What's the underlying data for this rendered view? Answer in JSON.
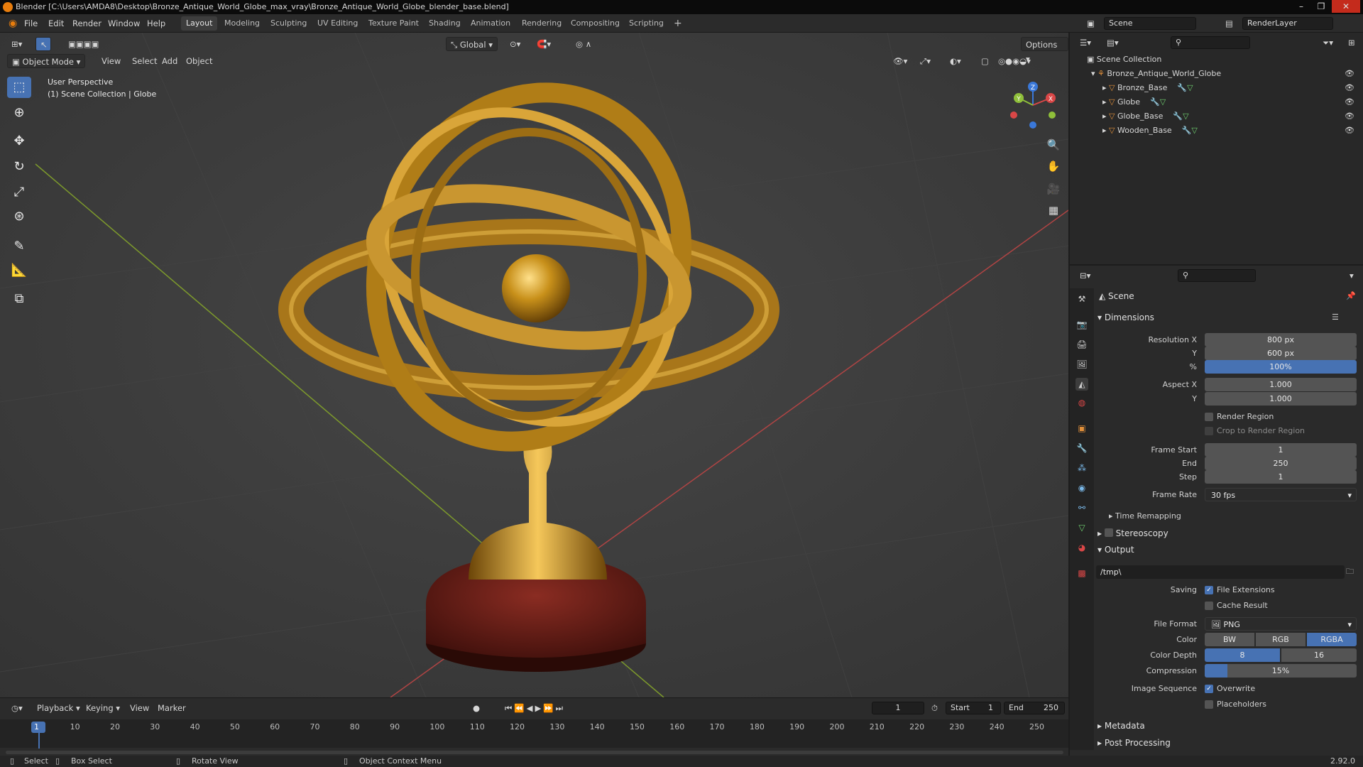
{
  "window": {
    "title": "Blender [C:\\Users\\AMDA8\\Desktop\\Bronze_Antique_World_Globe_max_vray\\Bronze_Antique_World_Globe_blender_base.blend]"
  },
  "menus": [
    "File",
    "Edit",
    "Render",
    "Window",
    "Help"
  ],
  "workspace_tabs": [
    "Layout",
    "Modeling",
    "Sculpting",
    "UV Editing",
    "Texture Paint",
    "Shading",
    "Animation",
    "Rendering",
    "Compositing",
    "Scripting"
  ],
  "active_workspace": "Layout",
  "scene_field": "Scene",
  "view_layer_field": "RenderLayer",
  "viewport": {
    "mode": "Object Mode",
    "menu": [
      "View",
      "Select",
      "Add",
      "Object"
    ],
    "transform_orientation": "Global",
    "options": "Options",
    "overlay_title": "User Perspective",
    "overlay_subtitle": "(1) Scene Collection | Globe",
    "gizmo": {
      "x": "X",
      "y": "Y",
      "z": "Z"
    }
  },
  "outliner": {
    "root": "Scene Collection",
    "collection": "Bronze_Antique_World_Globe",
    "objects": [
      "Bronze_Base",
      "Globe",
      "Globe_Base",
      "Wooden_Base"
    ]
  },
  "properties": {
    "context": "Scene",
    "dimensions": {
      "header": "Dimensions",
      "resolution_x_label": "Resolution X",
      "resolution_x": "800 px",
      "resolution_y_label": "Y",
      "resolution_y": "600 px",
      "percent_label": "%",
      "percent": "100%",
      "aspect_x_label": "Aspect X",
      "aspect_x": "1.000",
      "aspect_y_label": "Y",
      "aspect_y": "1.000",
      "render_region": "Render Region",
      "crop_region": "Crop to Render Region",
      "frame_start_label": "Frame Start",
      "frame_start": "1",
      "end_label": "End",
      "end": "250",
      "step_label": "Step",
      "step": "1",
      "frame_rate_label": "Frame Rate",
      "frame_rate": "30 fps",
      "time_remapping": "Time Remapping"
    },
    "stereoscopy": "Stereoscopy",
    "output": {
      "header": "Output",
      "path": "/tmp\\",
      "saving_label": "Saving",
      "file_extensions": "File Extensions",
      "cache_result": "Cache Result",
      "file_format_label": "File Format",
      "file_format": "PNG",
      "color_label": "Color",
      "color_options": [
        "BW",
        "RGB",
        "RGBA"
      ],
      "color_selected": "RGBA",
      "color_depth_label": "Color Depth",
      "color_depth_options": [
        "8",
        "16"
      ],
      "compression_label": "Compression",
      "compression": "15%",
      "compression_fraction": 0.15,
      "image_sequence_label": "Image Sequence",
      "overwrite": "Overwrite",
      "placeholders": "Placeholders"
    },
    "metadata": "Metadata",
    "post_processing": "Post Processing"
  },
  "timeline": {
    "menus": [
      "Playback",
      "Keying",
      "View",
      "Marker"
    ],
    "current_frame": "1",
    "start_label": "Start",
    "start": "1",
    "end_label": "End",
    "end": "250",
    "ticks": [
      "1",
      "10",
      "20",
      "30",
      "40",
      "50",
      "60",
      "70",
      "80",
      "90",
      "100",
      "110",
      "120",
      "130",
      "140",
      "150",
      "160",
      "170",
      "180",
      "190",
      "200",
      "210",
      "220",
      "230",
      "240",
      "250"
    ]
  },
  "statusbar": {
    "select": "Select",
    "box_select": "Box Select",
    "rotate_view": "Rotate View",
    "context_menu": "Object Context Menu",
    "version": "2.92.0"
  },
  "colors": {
    "accent": "#4772b3",
    "x_axis": "#d94747",
    "y_axis": "#8fbf3a",
    "z_axis": "#3a78d9"
  }
}
